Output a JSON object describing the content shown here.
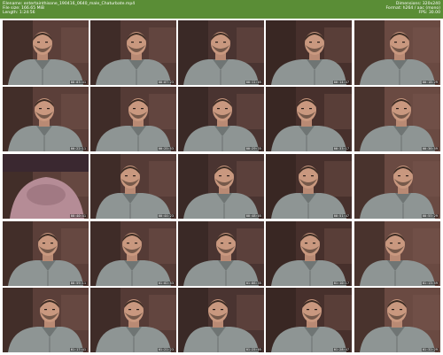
{
  "header": {
    "filename": "Filename: entertainthisone_190416_0640_male_Chaturbate.mp4",
    "filesize": "File size: 166.65 MiB",
    "length": "Length: 1:24:56",
    "dimensions": "Dimensions: 320x240",
    "format": "Format: h264 / aac (mono)",
    "fps": "FPS: 30.00"
  },
  "colors": {
    "header_bg": "#5a8d36",
    "header_text": "#ffffff"
  },
  "thumbnails": [
    {
      "timestamp": "00:03:41",
      "variant": "shirt"
    },
    {
      "timestamp": "00:07:23",
      "variant": "shirt"
    },
    {
      "timestamp": "00:11:05",
      "variant": "shirt"
    },
    {
      "timestamp": "00:14:47",
      "variant": "shirt"
    },
    {
      "timestamp": "00:18:29",
      "variant": "shirt"
    },
    {
      "timestamp": "00:22:11",
      "variant": "shirt"
    },
    {
      "timestamp": "00:25:53",
      "variant": "shirt"
    },
    {
      "timestamp": "00:29:35",
      "variant": "shirt"
    },
    {
      "timestamp": "00:33:17",
      "variant": "shirt"
    },
    {
      "timestamp": "00:36:59",
      "variant": "shirt"
    },
    {
      "timestamp": "00:40:41",
      "variant": "bare"
    },
    {
      "timestamp": "00:44:23",
      "variant": "shirt"
    },
    {
      "timestamp": "00:48:05",
      "variant": "shirt"
    },
    {
      "timestamp": "00:51:47",
      "variant": "shirt"
    },
    {
      "timestamp": "00:55:29",
      "variant": "shirt"
    },
    {
      "timestamp": "00:59:11",
      "variant": "shirt"
    },
    {
      "timestamp": "01:02:53",
      "variant": "shirt"
    },
    {
      "timestamp": "01:06:35",
      "variant": "shirt"
    },
    {
      "timestamp": "01:10:17",
      "variant": "shirt"
    },
    {
      "timestamp": "01:13:59",
      "variant": "shirt"
    },
    {
      "timestamp": "01:17:41",
      "variant": "shirt"
    },
    {
      "timestamp": "01:21:23",
      "variant": "shirt"
    },
    {
      "timestamp": "01:25:05",
      "variant": "shirt"
    },
    {
      "timestamp": "01:28:47",
      "variant": "shirt"
    },
    {
      "timestamp": "01:32:29",
      "variant": "shirt"
    }
  ]
}
